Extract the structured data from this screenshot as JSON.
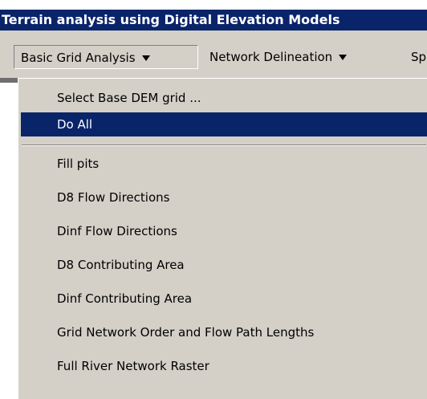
{
  "window": {
    "title": "Terrain analysis using Digital Elevation Models"
  },
  "menubar": {
    "menus": [
      {
        "label": "Basic Grid Analysis"
      },
      {
        "label": "Network Delineation"
      },
      {
        "label": "Sp"
      }
    ]
  },
  "dropdown": {
    "items": [
      {
        "label": "Select Base DEM grid ..."
      },
      {
        "label": "Do All"
      },
      {
        "label": "Fill pits"
      },
      {
        "label": "D8 Flow Directions"
      },
      {
        "label": "Dinf Flow Directions"
      },
      {
        "label": "D8 Contributing Area"
      },
      {
        "label": "Dinf Contributing Area"
      },
      {
        "label": "Grid Network Order and Flow Path Lengths"
      },
      {
        "label": "Full River Network Raster"
      }
    ]
  },
  "colors": {
    "highlight": "#0a246a",
    "menu_background": "#d4d0c8"
  }
}
